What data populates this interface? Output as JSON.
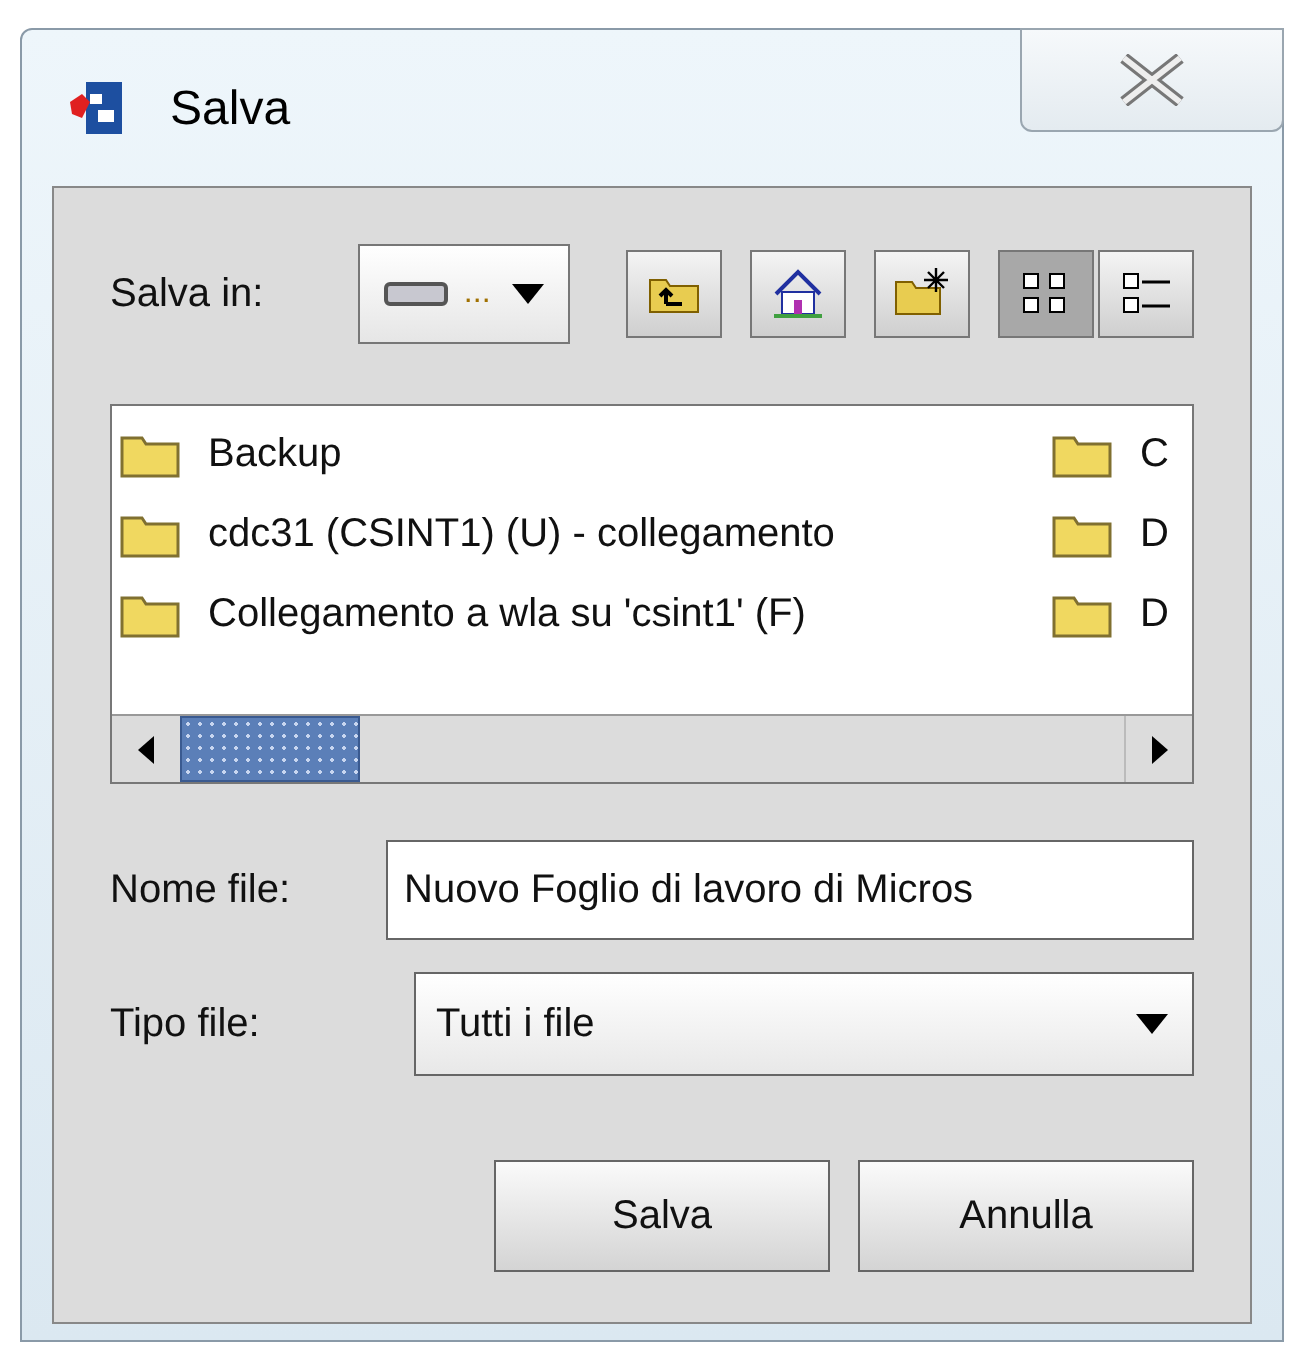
{
  "window": {
    "title": "Salva"
  },
  "save_in": {
    "label": "Salva in:",
    "value": "..."
  },
  "toolbar": [
    {
      "kind": "up"
    },
    {
      "kind": "home"
    },
    {
      "kind": "new-folder"
    },
    {
      "kind": "list-view",
      "selected": true
    },
    {
      "kind": "details-view",
      "selected": false
    }
  ],
  "files": [
    {
      "name": "Backup"
    },
    {
      "name": "cdc31 (CSINT1) (U) - collegamento"
    },
    {
      "name": "Collegamento a wla su 'csint1' (F)"
    },
    {
      "name": "C"
    },
    {
      "name": "D"
    },
    {
      "name": "D"
    }
  ],
  "file_name": {
    "label": "Nome file:",
    "value": "Nuovo Foglio di lavoro di Micros"
  },
  "file_type": {
    "label": "Tipo file:",
    "value": "Tutti i file"
  },
  "buttons": [
    "Salva",
    "Annulla"
  ]
}
